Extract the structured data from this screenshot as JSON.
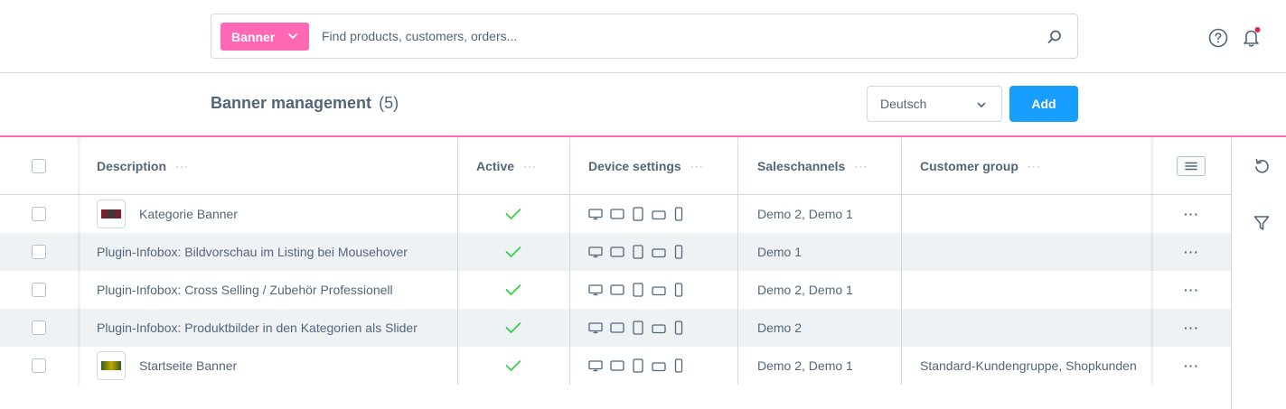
{
  "search": {
    "entity_label": "Banner",
    "placeholder": "Find products, customers, orders..."
  },
  "header": {
    "title": "Banner management",
    "count": "(5)",
    "language": "Deutsch",
    "add_label": "Add"
  },
  "colors": {
    "accent_pink": "#ff68b4",
    "primary_blue": "#189eff",
    "check_green": "#37d046",
    "notification_red": "#de294c"
  },
  "table": {
    "columns": {
      "description": "Description",
      "active": "Active",
      "device_settings": "Device settings",
      "saleschannels": "Saleschannels",
      "customer_group": "Customer group",
      "menu_dots": "···"
    },
    "rows": [
      {
        "description": "Kategorie Banner",
        "has_thumbnail": true,
        "thumbnail_colors": [
          "#8b1a2a",
          "#3a3a3a"
        ],
        "active": true,
        "saleschannels": "Demo 2, Demo 1",
        "customer_group": "",
        "actions": "···"
      },
      {
        "description": "Plugin-Infobox: Bildvorschau im Listing bei Mousehover",
        "has_thumbnail": false,
        "active": true,
        "saleschannels": "Demo 1",
        "customer_group": "",
        "actions": "···"
      },
      {
        "description": "Plugin-Infobox: Cross Selling / Zubehör Professionell",
        "has_thumbnail": false,
        "active": true,
        "saleschannels": "Demo 2, Demo 1",
        "customer_group": "",
        "actions": "···"
      },
      {
        "description": "Plugin-Infobox: Produktbilder in den Kategorien als Slider",
        "has_thumbnail": false,
        "active": true,
        "saleschannels": "Demo 2",
        "customer_group": "",
        "actions": "···"
      },
      {
        "description": "Startseite Banner",
        "has_thumbnail": true,
        "thumbnail_colors": [
          "#2f5d1e",
          "#c9a400"
        ],
        "active": true,
        "saleschannels": "Demo 2, Demo 1",
        "customer_group": "Standard-Kundengruppe, Shopkunden",
        "actions": "···"
      }
    ]
  },
  "icons": {
    "search": "magnifier-icon",
    "help": "question-circle-icon",
    "notifications": "bell-icon",
    "reset": "undo-icon",
    "filter": "funnel-icon",
    "devices": [
      "desktop-icon",
      "laptop-icon",
      "tablet-portrait-icon",
      "tablet-landscape-icon",
      "mobile-icon"
    ]
  }
}
